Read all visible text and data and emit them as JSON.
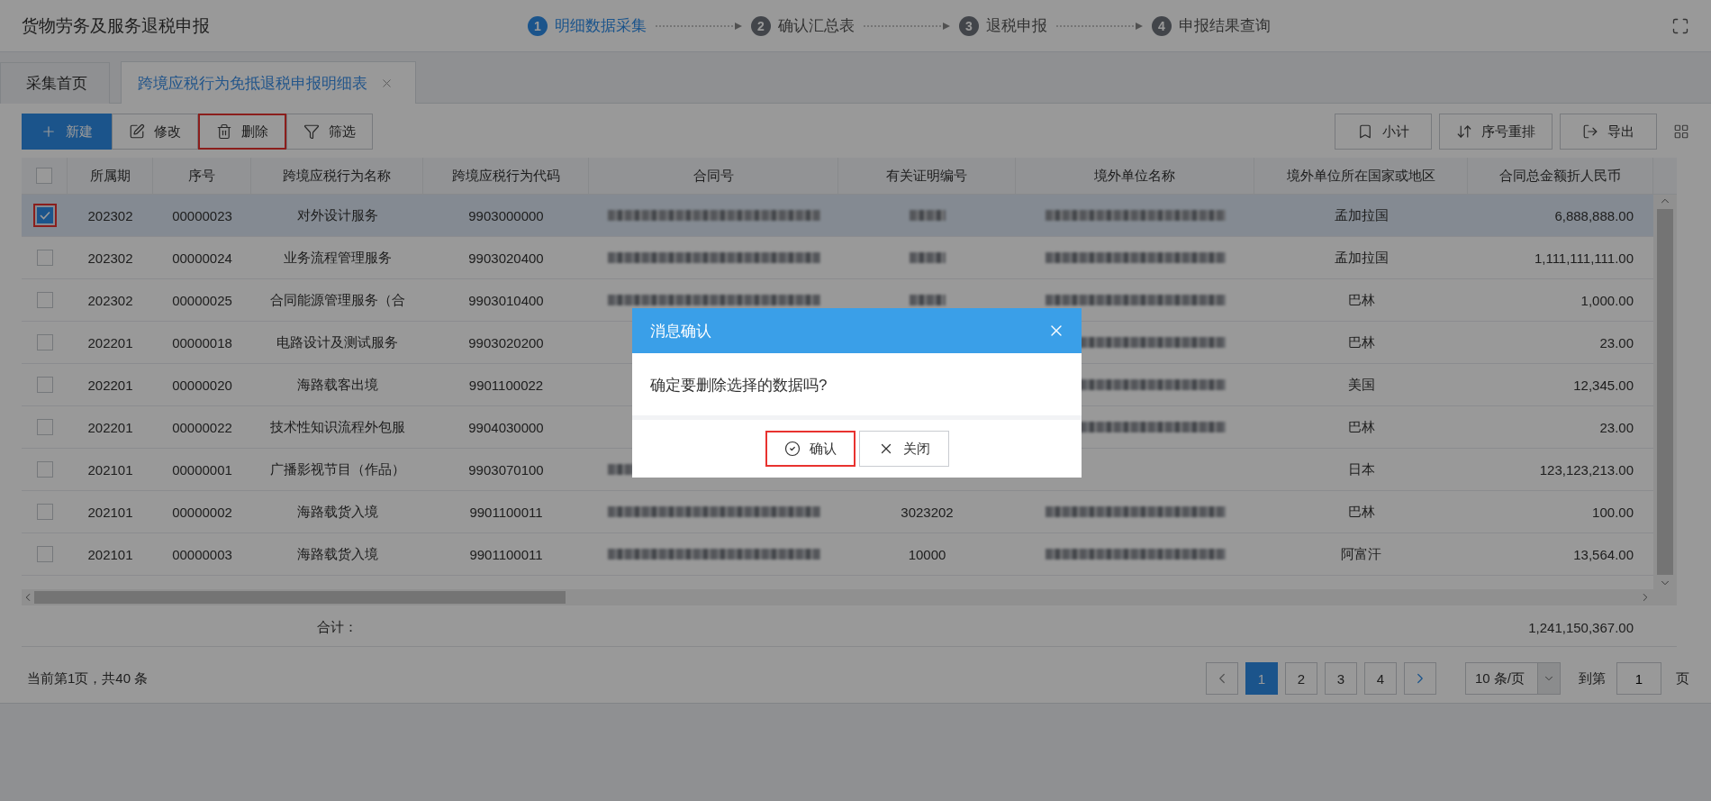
{
  "header": {
    "title": "货物劳务及服务退税申报",
    "steps": [
      {
        "number": "1",
        "label": "明细数据采集",
        "selected": true
      },
      {
        "number": "2",
        "label": "确认汇总表",
        "selected": false
      },
      {
        "number": "3",
        "label": "退税申报",
        "selected": false
      },
      {
        "number": "4",
        "label": "申报结果查询",
        "selected": false
      }
    ]
  },
  "tabs": [
    {
      "label": "采集首页",
      "selected": false,
      "closable": false
    },
    {
      "label": "跨境应税行为免抵退税申报明细表",
      "selected": true,
      "closable": true
    }
  ],
  "toolbar": {
    "left": [
      {
        "kind": "add",
        "label": "新建",
        "primary": true,
        "highlighted": false
      },
      {
        "kind": "edit",
        "label": "修改",
        "primary": false,
        "highlighted": false
      },
      {
        "kind": "delete",
        "label": "删除",
        "primary": false,
        "highlighted": true
      },
      {
        "kind": "filter",
        "label": "筛选",
        "primary": false,
        "highlighted": false
      }
    ],
    "right": [
      {
        "kind": "subtotal",
        "label": "小计"
      },
      {
        "kind": "reorder",
        "label": "序号重排"
      },
      {
        "kind": "export",
        "label": "导出"
      }
    ]
  },
  "table": {
    "all_checked": false,
    "columns": [
      "所属期",
      "序号",
      "跨境应税行为名称",
      "跨境应税行为代码",
      "合同号",
      "有关证明编号",
      "境外单位名称",
      "境外单位所在国家或地区",
      "合同总金额折人民币"
    ],
    "rows": [
      {
        "selected": true,
        "checked": true,
        "highlighted": true,
        "cells": [
          "202302",
          "00000023",
          "对外设计服务",
          "9903000000",
          {
            "kind": "redacted"
          },
          {
            "kind": "redacted"
          },
          {
            "kind": "redacted"
          },
          "孟加拉国",
          "6,888,888.00"
        ]
      },
      {
        "selected": false,
        "checked": false,
        "highlighted": false,
        "cells": [
          "202302",
          "00000024",
          "业务流程管理服务",
          "9903020400",
          {
            "kind": "redacted"
          },
          {
            "kind": "redacted"
          },
          {
            "kind": "redacted"
          },
          "孟加拉国",
          "1,111,111,111.00"
        ]
      },
      {
        "selected": false,
        "checked": false,
        "highlighted": false,
        "cells": [
          "202302",
          "00000025",
          "合同能源管理服务（合",
          "9903010400",
          {
            "kind": "redacted"
          },
          {
            "kind": "redacted"
          },
          {
            "kind": "redacted"
          },
          "巴林",
          "1,000.00"
        ]
      },
      {
        "selected": false,
        "checked": false,
        "highlighted": false,
        "cells": [
          "202201",
          "00000018",
          "电路设计及测试服务",
          "9903020200",
          null,
          null,
          {
            "kind": "redacted"
          },
          "巴林",
          "23.00"
        ]
      },
      {
        "selected": false,
        "checked": false,
        "highlighted": false,
        "cells": [
          "202201",
          "00000020",
          "海路载客出境",
          "9901100022",
          null,
          null,
          {
            "kind": "redacted"
          },
          "美国",
          "12,345.00"
        ]
      },
      {
        "selected": false,
        "checked": false,
        "highlighted": false,
        "cells": [
          "202201",
          "00000022",
          "技术性知识流程外包服",
          "9904030000",
          null,
          null,
          {
            "kind": "redacted"
          },
          "巴林",
          "23.00"
        ]
      },
      {
        "selected": false,
        "checked": false,
        "highlighted": false,
        "cells": [
          "202101",
          "00000001",
          "广播影视节目（作品）",
          "9903070100",
          {
            "kind": "redacted"
          },
          null,
          null,
          "日本",
          "123,123,213.00"
        ]
      },
      {
        "selected": false,
        "checked": false,
        "highlighted": false,
        "cells": [
          "202101",
          "00000002",
          "海路载货入境",
          "9901100011",
          {
            "kind": "redacted"
          },
          "3023202",
          {
            "kind": "redacted"
          },
          "巴林",
          "100.00"
        ]
      },
      {
        "selected": false,
        "checked": false,
        "highlighted": false,
        "cells": [
          "202101",
          "00000003",
          "海路载货入境",
          "9901100011",
          {
            "kind": "redacted"
          },
          "10000",
          {
            "kind": "redacted"
          },
          "阿富汗",
          "13,564.00"
        ]
      }
    ],
    "total": {
      "label": "合计：",
      "amount": "1,241,150,367.00"
    }
  },
  "pagination": {
    "summary": "当前第1页，共40 条",
    "pages": [
      {
        "label": "1",
        "selected": true
      },
      {
        "label": "2",
        "selected": false
      },
      {
        "label": "3",
        "selected": false
      },
      {
        "label": "4",
        "selected": false
      }
    ],
    "page_size": "10 条/页",
    "goto_label": "到第",
    "goto_value": "1",
    "goto_suffix": "页"
  },
  "dialog": {
    "title": "消息确认",
    "message": "确定要删除选择的数据吗?",
    "buttons": [
      {
        "kind": "confirm",
        "label": "确认",
        "highlighted": true
      },
      {
        "kind": "close",
        "label": "关闭",
        "highlighted": false
      }
    ]
  }
}
